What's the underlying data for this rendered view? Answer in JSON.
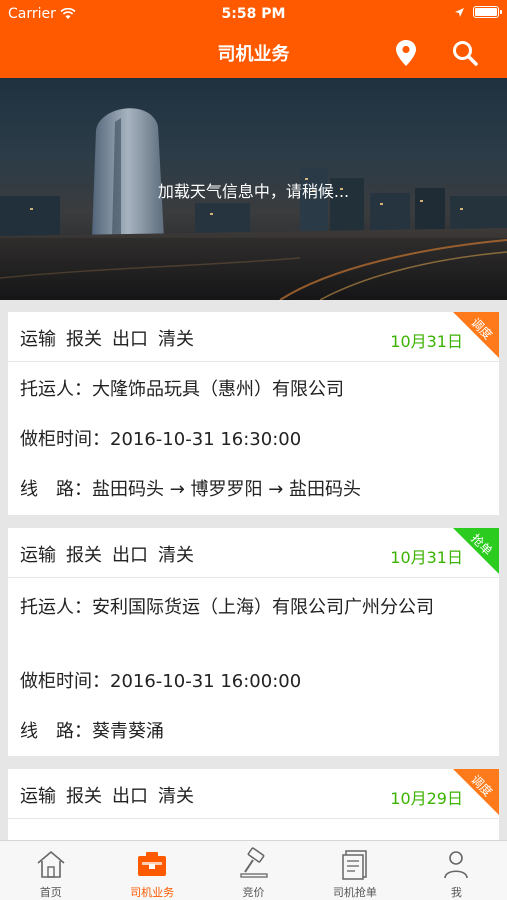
{
  "status": {
    "carrier": "Carrier",
    "time": "5:58 PM"
  },
  "nav": {
    "title": "司机业务"
  },
  "banner": {
    "weather_text": "加载天气信息中，请稍候..."
  },
  "orders": [
    {
      "tags": [
        "运输",
        "报关",
        "出口",
        "清关"
      ],
      "date": "10月31日",
      "badge": "调度",
      "badge_color": "#ff7a1a",
      "shipper_label": "托运人：",
      "shipper": "大隆饰品玩具（惠州）有限公司",
      "time_label": "做柜时间：",
      "time": "2016-10-31 16:30:00",
      "route_label": "线　路：",
      "route": "盐田码头 → 博罗罗阳 → 盐田码头"
    },
    {
      "tags": [
        "运输",
        "报关",
        "出口",
        "清关"
      ],
      "date": "10月31日",
      "badge": "抢单",
      "badge_color": "#2bcc1f",
      "shipper_label": "托运人：",
      "shipper": "安利国际货运（上海）有限公司广州分公司",
      "time_label": "做柜时间：",
      "time": "2016-10-31 16:00:00",
      "route_label": "线　路：",
      "route": "葵青葵涌"
    },
    {
      "tags": [
        "运输",
        "报关",
        "出口",
        "清关"
      ],
      "date": "10月29日",
      "badge": "调度",
      "badge_color": "#ff7a1a"
    }
  ],
  "tabs": [
    {
      "label": "首页",
      "icon": "home-icon"
    },
    {
      "label": "司机业务",
      "icon": "truck-icon"
    },
    {
      "label": "竞价",
      "icon": "gavel-icon"
    },
    {
      "label": "司机抢单",
      "icon": "document-icon"
    },
    {
      "label": "我",
      "icon": "person-icon"
    }
  ],
  "colors": {
    "accent": "#ff5a00",
    "date_green": "#3bb300",
    "ribbon_orange": "#ff7a1a",
    "ribbon_green": "#2bcc1f"
  }
}
